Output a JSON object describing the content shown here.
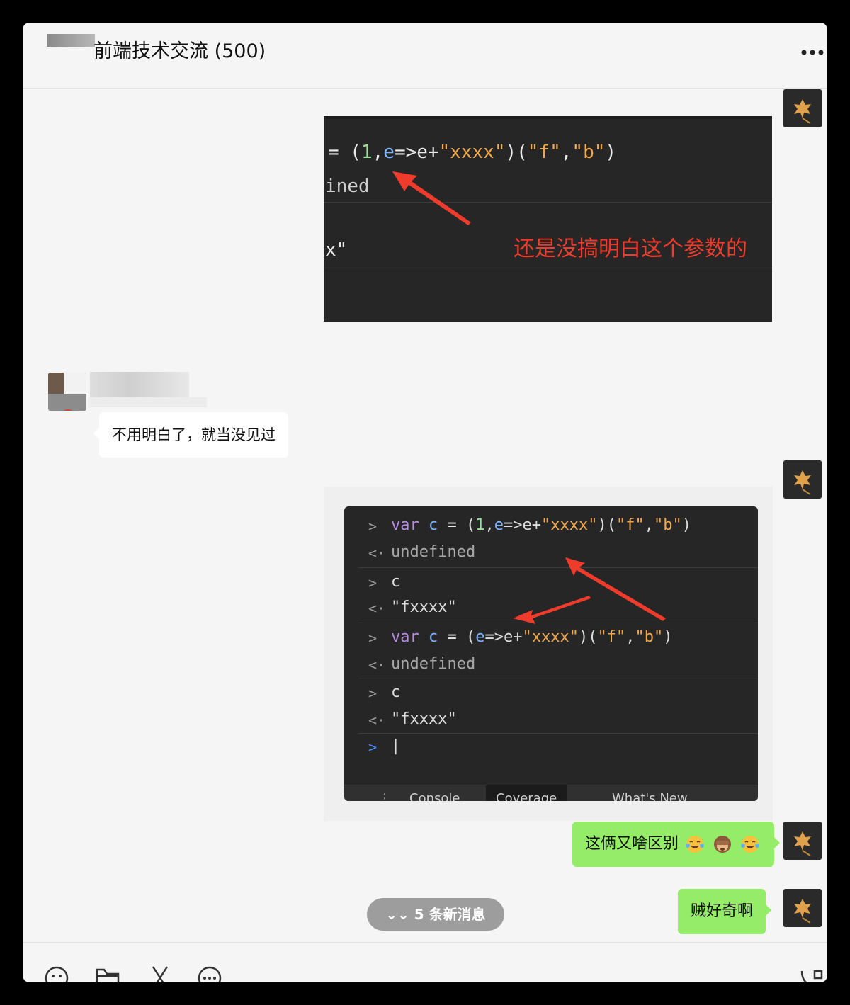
{
  "header": {
    "title": "前端技术交流 (500)",
    "more_icon": "more-icon"
  },
  "messages": {
    "img1": {
      "code_line1_prefix": "= (",
      "code_line1_num": "1",
      "code_line1_comma": ",",
      "code_line1_var": "e",
      "code_line1_arrow": "=>",
      "code_line1_e2": "e",
      "code_line1_plus": "+",
      "code_line1_str": "\"xxxx\"",
      "code_line1_rest": ")(",
      "code_line1_f": "\"f\"",
      "code_line1_comma2": ",",
      "code_line1_b": "\"b\"",
      "code_line1_end": ")",
      "code_line2": "ined",
      "code_line3": "x\"",
      "annotation": "还是没搞明白这个参数的"
    },
    "text_left": "不用明白了，就当没见过",
    "console": {
      "rows": [
        {
          "prefix": ">",
          "text": "var c = (1,e=>e+\"xxxx\")(\"f\",\"b\")"
        },
        {
          "prefix": "<·",
          "text": "undefined"
        },
        {
          "prefix": ">",
          "text": "c"
        },
        {
          "prefix": "<·",
          "text": "\"fxxxx\""
        },
        {
          "prefix": ">",
          "text": "var c = (e=>e+\"xxxx\")(\"f\",\"b\")"
        },
        {
          "prefix": "<·",
          "text": "undefined"
        },
        {
          "prefix": ">",
          "text": "c"
        },
        {
          "prefix": "<·",
          "text": "\"fxxxx\""
        },
        {
          "prefix": ">",
          "text": "|"
        }
      ],
      "tabs": [
        "Console",
        "Coverage",
        "What's New"
      ]
    },
    "text_right1": "这俩又啥区别",
    "text_right2": "贼好奇啊"
  },
  "new_messages": "5 条新消息",
  "toolbar": {
    "icons": [
      "emoji-icon",
      "folder-icon",
      "scissors-icon",
      "chat-icon",
      "phone-icon"
    ]
  },
  "colors": {
    "bubble_green": "#95ec69",
    "annotation_red": "#ee3b2b",
    "console_bg": "#262626"
  }
}
